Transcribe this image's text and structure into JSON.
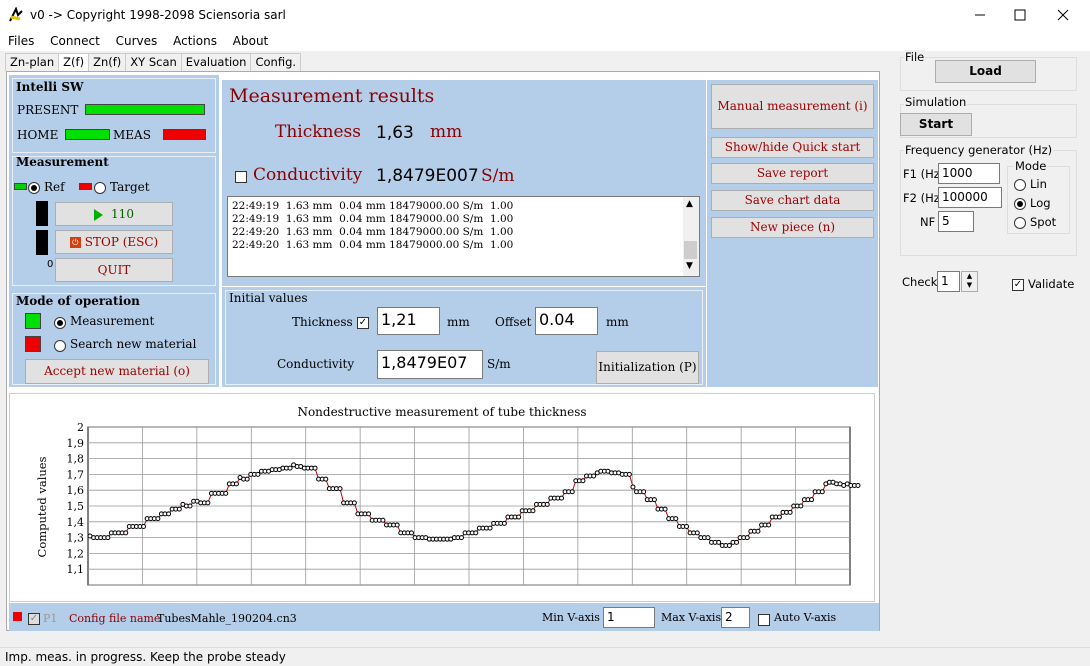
{
  "window": {
    "title": "v0 -> Copyright 1998-2098 Sciensoria sarl"
  },
  "menu": [
    "Files",
    "Connect",
    "Curves",
    "Actions",
    "About"
  ],
  "tabs": [
    "Zn-plan",
    "Z(f)",
    "Zn(f)",
    "XY Scan",
    "Evaluation",
    "Config."
  ],
  "intelli": {
    "title": "Intelli SW",
    "present": "PRESENT",
    "home": "HOME",
    "meas": "MEAS"
  },
  "measurement": {
    "title": "Measurement",
    "ref": "Ref",
    "target": "Target",
    "play_count": "110",
    "stop": "STOP (ESC)",
    "quit": "QUIT",
    "zero": "0"
  },
  "mode": {
    "title": "Mode of operation",
    "measurement": "Measurement",
    "search": "Search new material",
    "accept": "Accept new material (o)"
  },
  "results": {
    "title": "Measurement results",
    "thickness_label": "Thickness",
    "thickness_value": "1,63",
    "thickness_unit": "mm",
    "conductivity_label": "Conductivity",
    "conductivity_value": "1,8479E007",
    "conductivity_unit": "S/m",
    "log": [
      "22:49:19  1.63 mm  0.04 mm 18479000.00 S/m  1.00",
      "22:49:19  1.63 mm  0.04 mm 18479000.00 S/m  1.00",
      "22:49:20  1.63 mm  0.04 mm 18479000.00 S/m  1.00",
      "22:49:20  1.63 mm  0.04 mm 18479000.00 S/m  1.00"
    ]
  },
  "actions": {
    "manual": "Manual measurement (i)",
    "quickstart": "Show/hide Quick start",
    "report": "Save report",
    "chart": "Save chart data",
    "newpiece": "New piece (n)"
  },
  "initial": {
    "title": "Initial values",
    "thickness_label": "Thickness",
    "thickness_value": "1,21",
    "thickness_unit": "mm",
    "offset_label": "Offset",
    "offset_value": "0.04",
    "offset_unit": "mm",
    "conductivity_label": "Conductivity",
    "conductivity_value": "1,8479E07",
    "conductivity_unit": "S/m",
    "init_button": "Initialization (P)"
  },
  "chart_data": {
    "type": "line",
    "title": "Nondestructive measurement of tube thickness",
    "ylabel": "Computed values",
    "xlabel": "",
    "ylim": [
      1.0,
      2.0
    ],
    "yticks": [
      "2",
      "1,9",
      "1,8",
      "1,7",
      "1,6",
      "1,5",
      "1,4",
      "1,3",
      "1,2",
      "1,1"
    ],
    "grid": true,
    "color": "#cc0000",
    "values": [
      1.31,
      1.3,
      1.3,
      1.3,
      1.3,
      1.3,
      1.33,
      1.33,
      1.33,
      1.33,
      1.33,
      1.37,
      1.37,
      1.37,
      1.37,
      1.37,
      1.42,
      1.42,
      1.42,
      1.42,
      1.45,
      1.45,
      1.45,
      1.48,
      1.48,
      1.48,
      1.51,
      1.5,
      1.5,
      1.53,
      1.53,
      1.52,
      1.52,
      1.52,
      1.58,
      1.58,
      1.58,
      1.58,
      1.58,
      1.64,
      1.64,
      1.64,
      1.68,
      1.67,
      1.67,
      1.7,
      1.7,
      1.7,
      1.72,
      1.72,
      1.72,
      1.73,
      1.73,
      1.73,
      1.74,
      1.74,
      1.74,
      1.76,
      1.75,
      1.75,
      1.74,
      1.74,
      1.74,
      1.74,
      1.67,
      1.67,
      1.67,
      1.61,
      1.61,
      1.61,
      1.61,
      1.52,
      1.52,
      1.52,
      1.52,
      1.45,
      1.45,
      1.45,
      1.45,
      1.41,
      1.41,
      1.41,
      1.41,
      1.38,
      1.38,
      1.38,
      1.38,
      1.33,
      1.33,
      1.33,
      1.33,
      1.3,
      1.3,
      1.3,
      1.3,
      1.29,
      1.29,
      1.29,
      1.29,
      1.29,
      1.29,
      1.29,
      1.3,
      1.3,
      1.3,
      1.33,
      1.33,
      1.33,
      1.33,
      1.36,
      1.36,
      1.36,
      1.36,
      1.39,
      1.39,
      1.39,
      1.39,
      1.43,
      1.43,
      1.43,
      1.43,
      1.47,
      1.47,
      1.47,
      1.47,
      1.51,
      1.51,
      1.51,
      1.51,
      1.55,
      1.55,
      1.55,
      1.55,
      1.59,
      1.59,
      1.59,
      1.66,
      1.66,
      1.66,
      1.69,
      1.69,
      1.69,
      1.71,
      1.72,
      1.72,
      1.72,
      1.71,
      1.71,
      1.71,
      1.7,
      1.7,
      1.7,
      1.62,
      1.59,
      1.59,
      1.59,
      1.54,
      1.54,
      1.54,
      1.48,
      1.48,
      1.48,
      1.42,
      1.42,
      1.42,
      1.37,
      1.37,
      1.37,
      1.33,
      1.33,
      1.33,
      1.3,
      1.3,
      1.3,
      1.27,
      1.27,
      1.27,
      1.25,
      1.25,
      1.25,
      1.27,
      1.27,
      1.3,
      1.3,
      1.3,
      1.34,
      1.34,
      1.34,
      1.38,
      1.38,
      1.38,
      1.43,
      1.43,
      1.43,
      1.46,
      1.46,
      1.46,
      1.5,
      1.5,
      1.5,
      1.54,
      1.54,
      1.54,
      1.59,
      1.59,
      1.59,
      1.64,
      1.65,
      1.65,
      1.64,
      1.64,
      1.63,
      1.64,
      1.63,
      1.63,
      1.63
    ]
  },
  "chart_footer": {
    "p1": "P1",
    "config_label": "Config file name",
    "config_value": "TubesMahle_190204.cn3",
    "min_label": "Min V-axis",
    "min_value": "1",
    "max_label": "Max V-axis",
    "max_value": "2",
    "auto": "Auto V-axis"
  },
  "side": {
    "file_title": "File",
    "load": "Load",
    "sim_title": "Simulation",
    "start": "Start",
    "freq_title": "Frequency generator (Hz)",
    "f1_label": "F1 (Hz)",
    "f1_value": "1000",
    "f2_label": "F2 (Hz)",
    "f2_value": "100000",
    "nf_label": "NF",
    "nf_value": "5",
    "mode_title": "Mode",
    "lin": "Lin",
    "log": "Log",
    "spot": "Spot",
    "check_label": "Check",
    "check_value": "1",
    "validate": "Validate"
  },
  "status": "Imp. meas. in progress. Keep the probe steady"
}
